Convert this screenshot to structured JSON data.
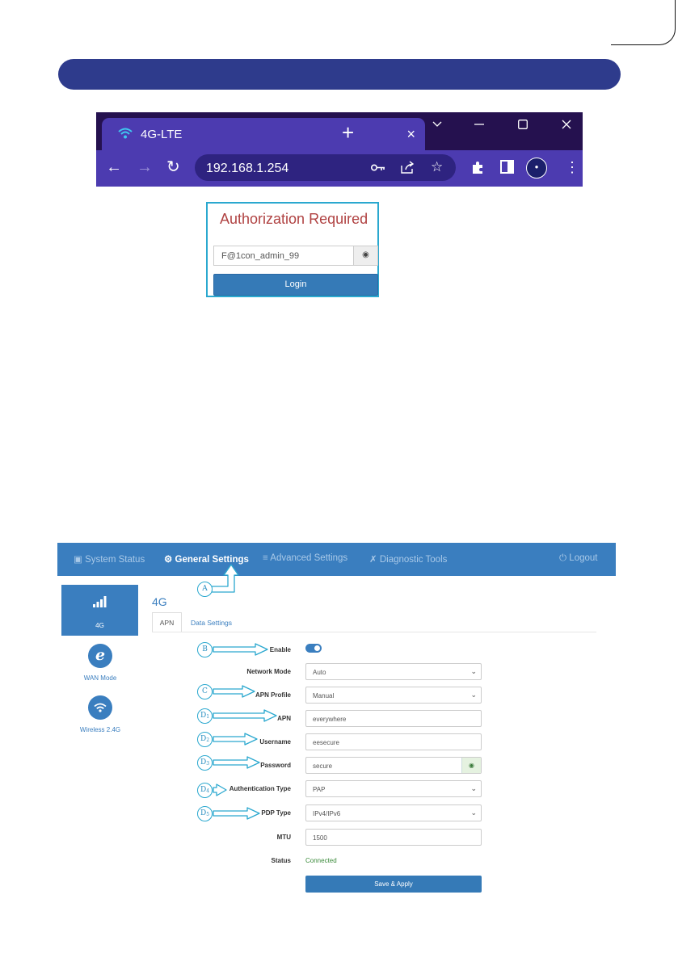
{
  "browser": {
    "tab_title": "4G-LTE",
    "tab_close": "×",
    "new_tab": "+",
    "url": "192.168.1.254"
  },
  "login": {
    "title": "Authorization Required",
    "password_value": "F@1con_admin_99",
    "button": "Login"
  },
  "router": {
    "nav": [
      {
        "label": "System Status",
        "icon": "monitor-icon"
      },
      {
        "label": "General Settings",
        "icon": "gear-icon"
      },
      {
        "label": "Advanced Settings",
        "icon": "sliders-icon"
      },
      {
        "label": "Diagnostic Tools",
        "icon": "tools-icon"
      },
      {
        "label": "Logout",
        "icon": "power-icon"
      }
    ],
    "sidebar": [
      {
        "label": "4G",
        "icon": "signal-bars-icon"
      },
      {
        "label": "WAN Mode",
        "icon": "ie-globe-icon"
      },
      {
        "label": "Wireless 2.4G",
        "icon": "wifi-icon"
      }
    ],
    "page_title": "4G",
    "tabs": [
      "APN",
      "Data Settings"
    ],
    "fields": {
      "enable": {
        "label": "Enable",
        "value": true
      },
      "network_mode": {
        "label": "Network Mode",
        "value": "Auto"
      },
      "apn_profile": {
        "label": "APN Profile",
        "value": "Manual"
      },
      "apn": {
        "label": "APN",
        "value": "everywhere"
      },
      "username": {
        "label": "Username",
        "value": "eesecure"
      },
      "password": {
        "label": "Password",
        "value": "secure"
      },
      "auth_type": {
        "label": "Authentication Type",
        "value": "PAP"
      },
      "pdp_type": {
        "label": "PDP Type",
        "value": "IPv4/IPv6"
      },
      "mtu": {
        "label": "MTU",
        "value": "1500"
      },
      "status": {
        "label": "Status",
        "value": "Connected"
      }
    },
    "save_button": "Save & Apply"
  },
  "callouts": {
    "a": "A",
    "b": "B",
    "c": "C",
    "d": "D",
    "d1": "1",
    "d2": "2",
    "d3": "3",
    "d4": "4",
    "d5": "5"
  },
  "colors": {
    "header_bar": "#2e3b8c",
    "browser_frame": "#25114f",
    "browser_toolbar": "#4c3bb0",
    "router_accent": "#3a7ebf",
    "callout": "#2aa8cf",
    "login_title": "#b04242"
  }
}
